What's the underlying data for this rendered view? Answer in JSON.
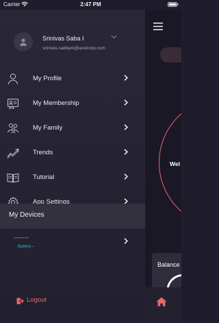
{
  "status_bar": {
    "carrier": "Carrier",
    "time": "2:47 PM",
    "wifi_icon": "wifi-icon",
    "battery_icon": "battery-icon"
  },
  "drawer": {
    "profile": {
      "name": "Srinivas Saba I",
      "email": "srinivas.sabbani@acelcorp.com",
      "avatar_icon": "person-icon",
      "chevron_icon": "chevron-down-icon"
    },
    "menu_items": [
      {
        "label": "My Profile",
        "icon": "person-icon"
      },
      {
        "label": "My Membership",
        "icon": "membership-card-icon"
      },
      {
        "label": "My Family",
        "icon": "family-icon"
      },
      {
        "label": "Trends",
        "icon": "trend-icon"
      },
      {
        "label": "Tutorial",
        "icon": "book-icon"
      },
      {
        "label": "App Settings",
        "icon": "gear-icon"
      }
    ],
    "devices": {
      "header": "My Devices",
      "items": [
        {
          "name": "-------",
          "battery": "Battery:--"
        }
      ]
    },
    "logout": {
      "label": "Logout",
      "icon": "logout-icon"
    }
  },
  "main": {
    "welcome_text": "Wel",
    "balance_text": "Balance",
    "menu_icon": "hamburger-icon",
    "home_icon": "home-icon"
  },
  "colors": {
    "drawer_bg": "#2a2737",
    "accent_red": "#e86b6b",
    "battery_text": "#23c0c9",
    "main_bg": "#1b1826"
  }
}
